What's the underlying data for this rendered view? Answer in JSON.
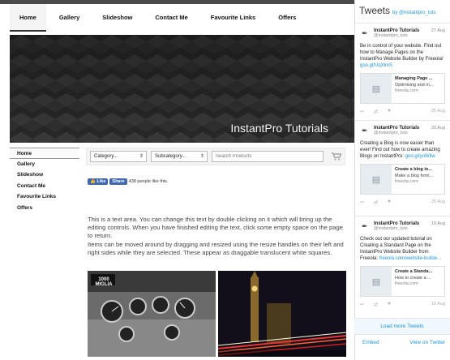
{
  "nav": {
    "items": [
      {
        "label": "Home"
      },
      {
        "label": "Gallery"
      },
      {
        "label": "Slideshow"
      },
      {
        "label": "Contact Me"
      },
      {
        "label": "Favourite Links"
      },
      {
        "label": "Offers"
      }
    ],
    "active_index": 0
  },
  "hero": {
    "title": "InstantPro Tutorials"
  },
  "sidebar": {
    "items": [
      {
        "label": "Home"
      },
      {
        "label": "Gallery"
      },
      {
        "label": "Slideshow"
      },
      {
        "label": "Contact Me"
      },
      {
        "label": "Favourite Links"
      },
      {
        "label": "Offers"
      }
    ]
  },
  "shop": {
    "category": "Category...",
    "subcategory": "Subcategory...",
    "search_placeholder": "Search Products"
  },
  "facebook": {
    "like": "Like",
    "share": "Share",
    "count_text": "438 people like this."
  },
  "content": {
    "para1": "This is a text area. You can change this text by double clicking on it which will bring up the editing controls. When you have finished editing the text, click some empty space on the page to return.",
    "para2": "Items can be moved around by dragging and resized using the resize handles on their left and right sides while they are selected. These appear as draggable translucent white squares."
  },
  "images": {
    "badge_1": "1000",
    "badge_2": "MIGLIA"
  },
  "twitter": {
    "title": "Tweets",
    "by": "by @instantpro_tuts",
    "tweets": [
      {
        "name": "InstantPro Tutorials",
        "handle": "@instantpro_tuts",
        "date": "27 Aug",
        "text": "Be in control of your website. Find out how to Manage Pages on the InstantPro Website Builder by Freeola! ",
        "link": "goo.gl/UqXlmS",
        "card_title": "Managing Page ...",
        "card_desc": "Optimising and m...",
        "card_domain": "freeola.com"
      },
      {
        "name": "InstantPro Tutorials",
        "handle": "@instantpro_tuts",
        "date": "20 Aug",
        "text": "Creating a Blog is now easier than ever! Find out how to create amazing Blogs on InstantPro: ",
        "link": "goo.gl/yoWilw",
        "card_title": "Create a blog in...",
        "card_desc": "Make a blog from...",
        "card_domain": "freeola.com"
      },
      {
        "name": "InstantPro Tutorials",
        "handle": "@instantpro_tuts",
        "date": "19 Aug",
        "text": "Check out our updated tutorial on Creating a Standard Page on the InstantPro Website Builder from Freeola: ",
        "link": "freeola.com/website-builde...",
        "card_title": "Create a Standa...",
        "card_desc": "How to create a ...",
        "card_domain": "freeola.com"
      }
    ],
    "dates_below": [
      "25 Aug",
      "20 Aug",
      "10 Aug"
    ],
    "load_more": "Load more Tweets",
    "embed": "Embed",
    "view": "View on Twitter"
  }
}
